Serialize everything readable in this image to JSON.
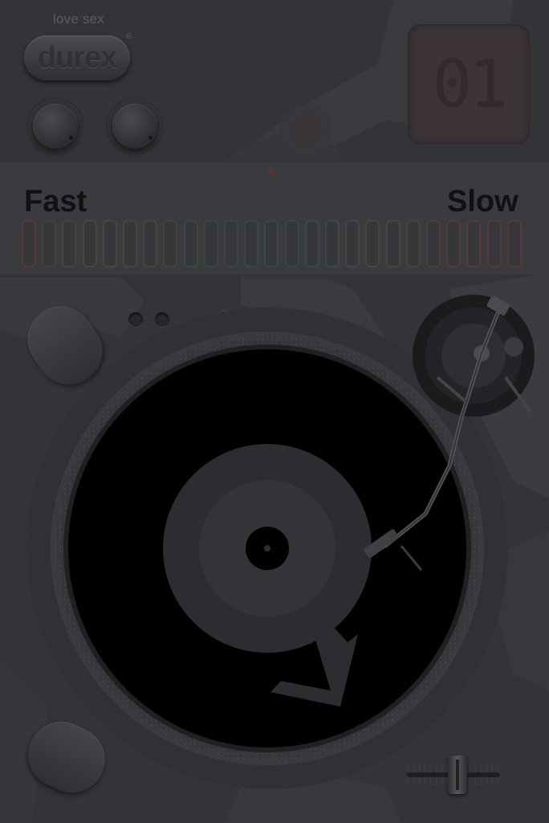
{
  "brand": {
    "tagline": "love sex",
    "logo": "durex",
    "trademark": "®"
  },
  "display": {
    "number": "01"
  },
  "speed": {
    "fast_label": "Fast",
    "slow_label": "Slow",
    "segment_count": 25,
    "segment_colors": [
      "#5a3a36",
      "#4f3e35",
      "#4d4034",
      "#4f4437",
      "#4b4638",
      "#474638",
      "#44463a",
      "#41463c",
      "#3f4640",
      "#3d4544",
      "#3c4548",
      "#3c454b",
      "#3c454c",
      "#3c4549",
      "#3e4646",
      "#404643",
      "#444640",
      "#47463d",
      "#4a443a",
      "#4c4238",
      "#4e4038",
      "#523d38",
      "#553b39",
      "#573a3a",
      "#59393a"
    ]
  },
  "icons": {
    "knob_left": "volume-knob-icon",
    "knob_right": "tone-knob-icon",
    "vinyl_arrow": "arrow-down-right-icon",
    "tonearm": "tonearm-icon",
    "fader": "pitch-fader-icon"
  },
  "colors": {
    "background": "#333437",
    "speed_bar": "#3a3b3e",
    "label_dark": "#111113",
    "vinyl": "#000000",
    "vinyl_label": "#2c2d31"
  }
}
